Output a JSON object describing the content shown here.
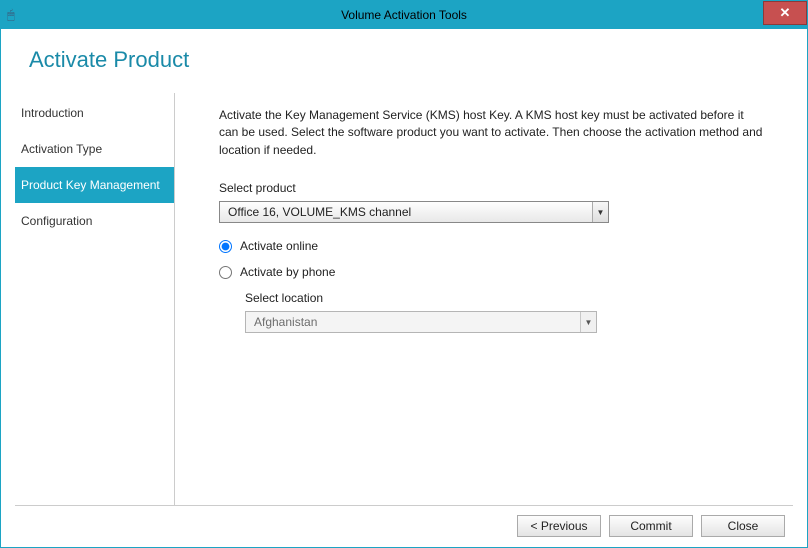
{
  "window": {
    "title": "Volume Activation Tools",
    "close_glyph": "✕"
  },
  "page": {
    "title": "Activate Product"
  },
  "sidebar": {
    "items": [
      {
        "label": "Introduction",
        "active": false
      },
      {
        "label": "Activation Type",
        "active": false
      },
      {
        "label": "Product Key Management",
        "active": true
      },
      {
        "label": "Configuration",
        "active": false
      }
    ]
  },
  "main": {
    "instruction": "Activate the Key Management Service (KMS) host Key. A KMS host key must be activated before it can be used. Select the software product you want to activate. Then choose the activation method and location if needed.",
    "select_product_label": "Select product",
    "product_value": "Office 16, VOLUME_KMS channel",
    "radios": {
      "online_label": "Activate online",
      "phone_label": "Activate by phone",
      "selected": "online"
    },
    "select_location_label": "Select location",
    "location_value": "Afghanistan"
  },
  "footer": {
    "previous": "<  Previous",
    "commit": "Commit",
    "close": "Close"
  }
}
